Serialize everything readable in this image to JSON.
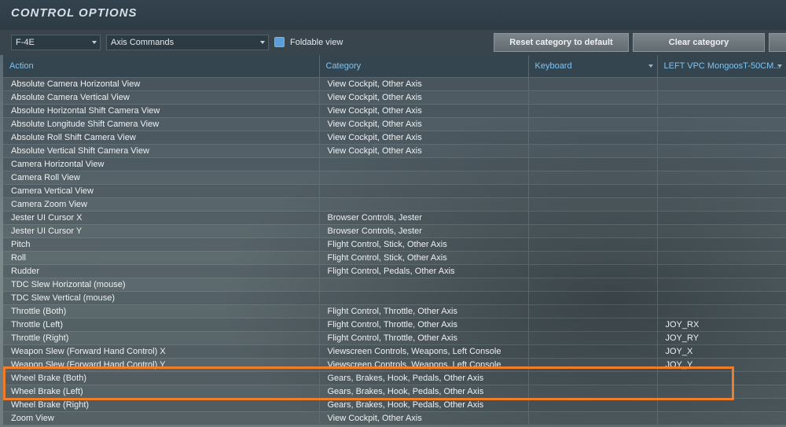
{
  "title": "CONTROL OPTIONS",
  "toolbar": {
    "aircraft_select": "F-4E",
    "category_select": "Axis Commands",
    "foldable_label": "Foldable view",
    "reset_label": "Reset category to default",
    "clear_label": "Clear category"
  },
  "columns": [
    "Action",
    "Category",
    "Keyboard",
    "LEFT VPC MongoosT-50CM..."
  ],
  "rows": [
    {
      "action": "Absolute Camera Horizontal View",
      "category": "View Cockpit, Other Axis",
      "keyboard": "",
      "joy": ""
    },
    {
      "action": "Absolute Camera Vertical View",
      "category": "View Cockpit, Other Axis",
      "keyboard": "",
      "joy": ""
    },
    {
      "action": "Absolute Horizontal Shift Camera View",
      "category": "View Cockpit, Other Axis",
      "keyboard": "",
      "joy": ""
    },
    {
      "action": "Absolute Longitude Shift Camera View",
      "category": "View Cockpit, Other Axis",
      "keyboard": "",
      "joy": ""
    },
    {
      "action": "Absolute Roll Shift Camera View",
      "category": "View Cockpit, Other Axis",
      "keyboard": "",
      "joy": ""
    },
    {
      "action": "Absolute Vertical Shift Camera View",
      "category": "View Cockpit, Other Axis",
      "keyboard": "",
      "joy": ""
    },
    {
      "action": "Camera Horizontal View",
      "category": "",
      "keyboard": "",
      "joy": ""
    },
    {
      "action": "Camera Roll View",
      "category": "",
      "keyboard": "",
      "joy": ""
    },
    {
      "action": "Camera Vertical View",
      "category": "",
      "keyboard": "",
      "joy": ""
    },
    {
      "action": "Camera Zoom View",
      "category": "",
      "keyboard": "",
      "joy": ""
    },
    {
      "action": "Jester UI Cursor X",
      "category": "Browser Controls, Jester",
      "keyboard": "",
      "joy": ""
    },
    {
      "action": "Jester UI Cursor Y",
      "category": "Browser Controls, Jester",
      "keyboard": "",
      "joy": ""
    },
    {
      "action": "Pitch",
      "category": "Flight Control, Stick, Other Axis",
      "keyboard": "",
      "joy": ""
    },
    {
      "action": "Roll",
      "category": "Flight Control, Stick, Other Axis",
      "keyboard": "",
      "joy": ""
    },
    {
      "action": "Rudder",
      "category": "Flight Control, Pedals, Other Axis",
      "keyboard": "",
      "joy": ""
    },
    {
      "action": "TDC Slew Horizontal (mouse)",
      "category": "",
      "keyboard": "",
      "joy": ""
    },
    {
      "action": "TDC Slew Vertical (mouse)",
      "category": "",
      "keyboard": "",
      "joy": ""
    },
    {
      "action": "Throttle (Both)",
      "category": "Flight Control, Throttle, Other Axis",
      "keyboard": "",
      "joy": ""
    },
    {
      "action": "Throttle (Left)",
      "category": "Flight Control, Throttle, Other Axis",
      "keyboard": "",
      "joy": "JOY_RX"
    },
    {
      "action": "Throttle (Right)",
      "category": "Flight Control, Throttle, Other Axis",
      "keyboard": "",
      "joy": "JOY_RY"
    },
    {
      "action": "Weapon Slew (Forward Hand Control) X",
      "category": "Viewscreen Controls, Weapons, Left Console",
      "keyboard": "",
      "joy": "JOY_X"
    },
    {
      "action": "Weapon Slew (Forward Hand Control) Y",
      "category": "Viewscreen Controls, Weapons, Left Console",
      "keyboard": "",
      "joy": "JOY_Y"
    },
    {
      "action": "Wheel Brake (Both)",
      "category": "Gears, Brakes, Hook, Pedals, Other Axis",
      "keyboard": "",
      "joy": ""
    },
    {
      "action": "Wheel Brake (Left)",
      "category": "Gears, Brakes, Hook, Pedals, Other Axis",
      "keyboard": "",
      "joy": ""
    },
    {
      "action": "Wheel Brake (Right)",
      "category": "Gears, Brakes, Hook, Pedals, Other Axis",
      "keyboard": "",
      "joy": ""
    },
    {
      "action": "Zoom View",
      "category": "View Cockpit, Other Axis",
      "keyboard": "",
      "joy": ""
    }
  ],
  "colors": {
    "highlight": "#f07d2a",
    "header_text": "#7fc3ef",
    "checkbox": "#5b9fd8"
  }
}
